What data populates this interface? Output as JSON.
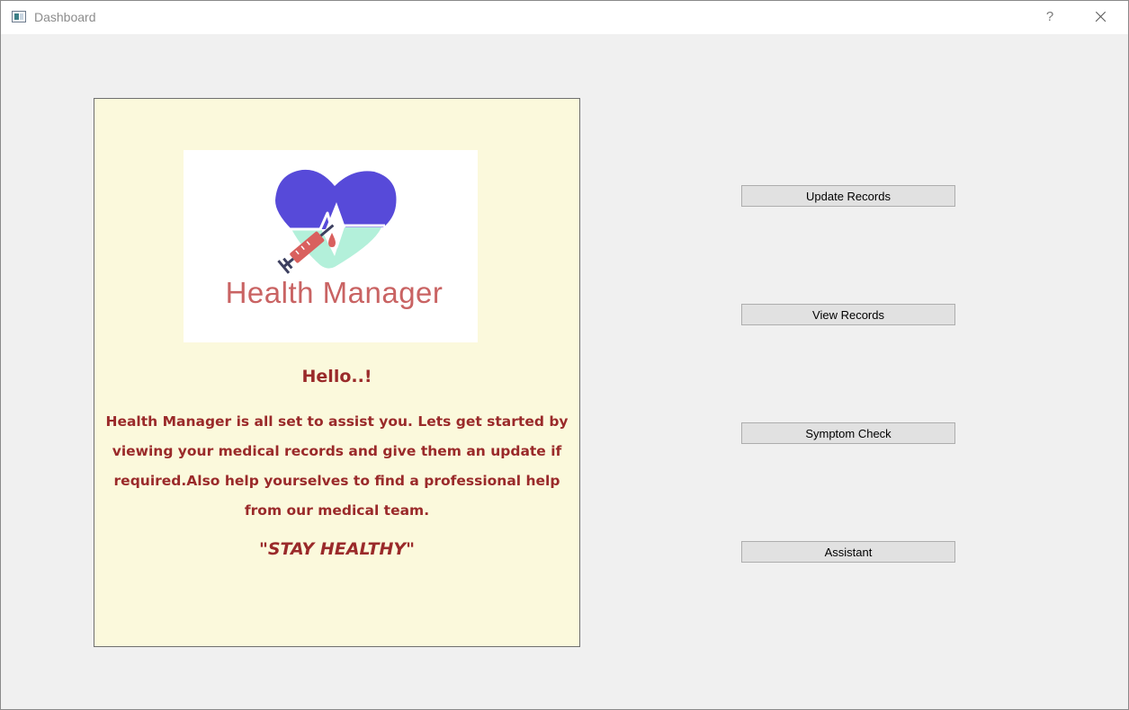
{
  "window": {
    "title": "Dashboard",
    "help_label": "?",
    "close_label": "close"
  },
  "panel": {
    "logo_text": "Health Manager",
    "greeting": "Hello..!",
    "message": "Health Manager is all set to assist you. Lets get started by viewing your medical  records and  give them an update if required.Also help yourselves to find a professional help from our medical team.",
    "motto": "\"STAY HEALTHY\""
  },
  "buttons": {
    "update_records": "Update Records",
    "view_records": "View Records",
    "symptom_check": "Symptom Check",
    "assistant": "Assistant"
  },
  "colors": {
    "panel_bg": "#fbf9dc",
    "text_accent": "#9a2a2a",
    "logo_heart": "#574ad9",
    "logo_wave": "#b3f0da",
    "logo_syringe": "#d9605e",
    "logo_text": "#c96363"
  },
  "icons": [
    "app-window-icon",
    "heart-logo-icon",
    "syringe-icon",
    "close-icon"
  ]
}
